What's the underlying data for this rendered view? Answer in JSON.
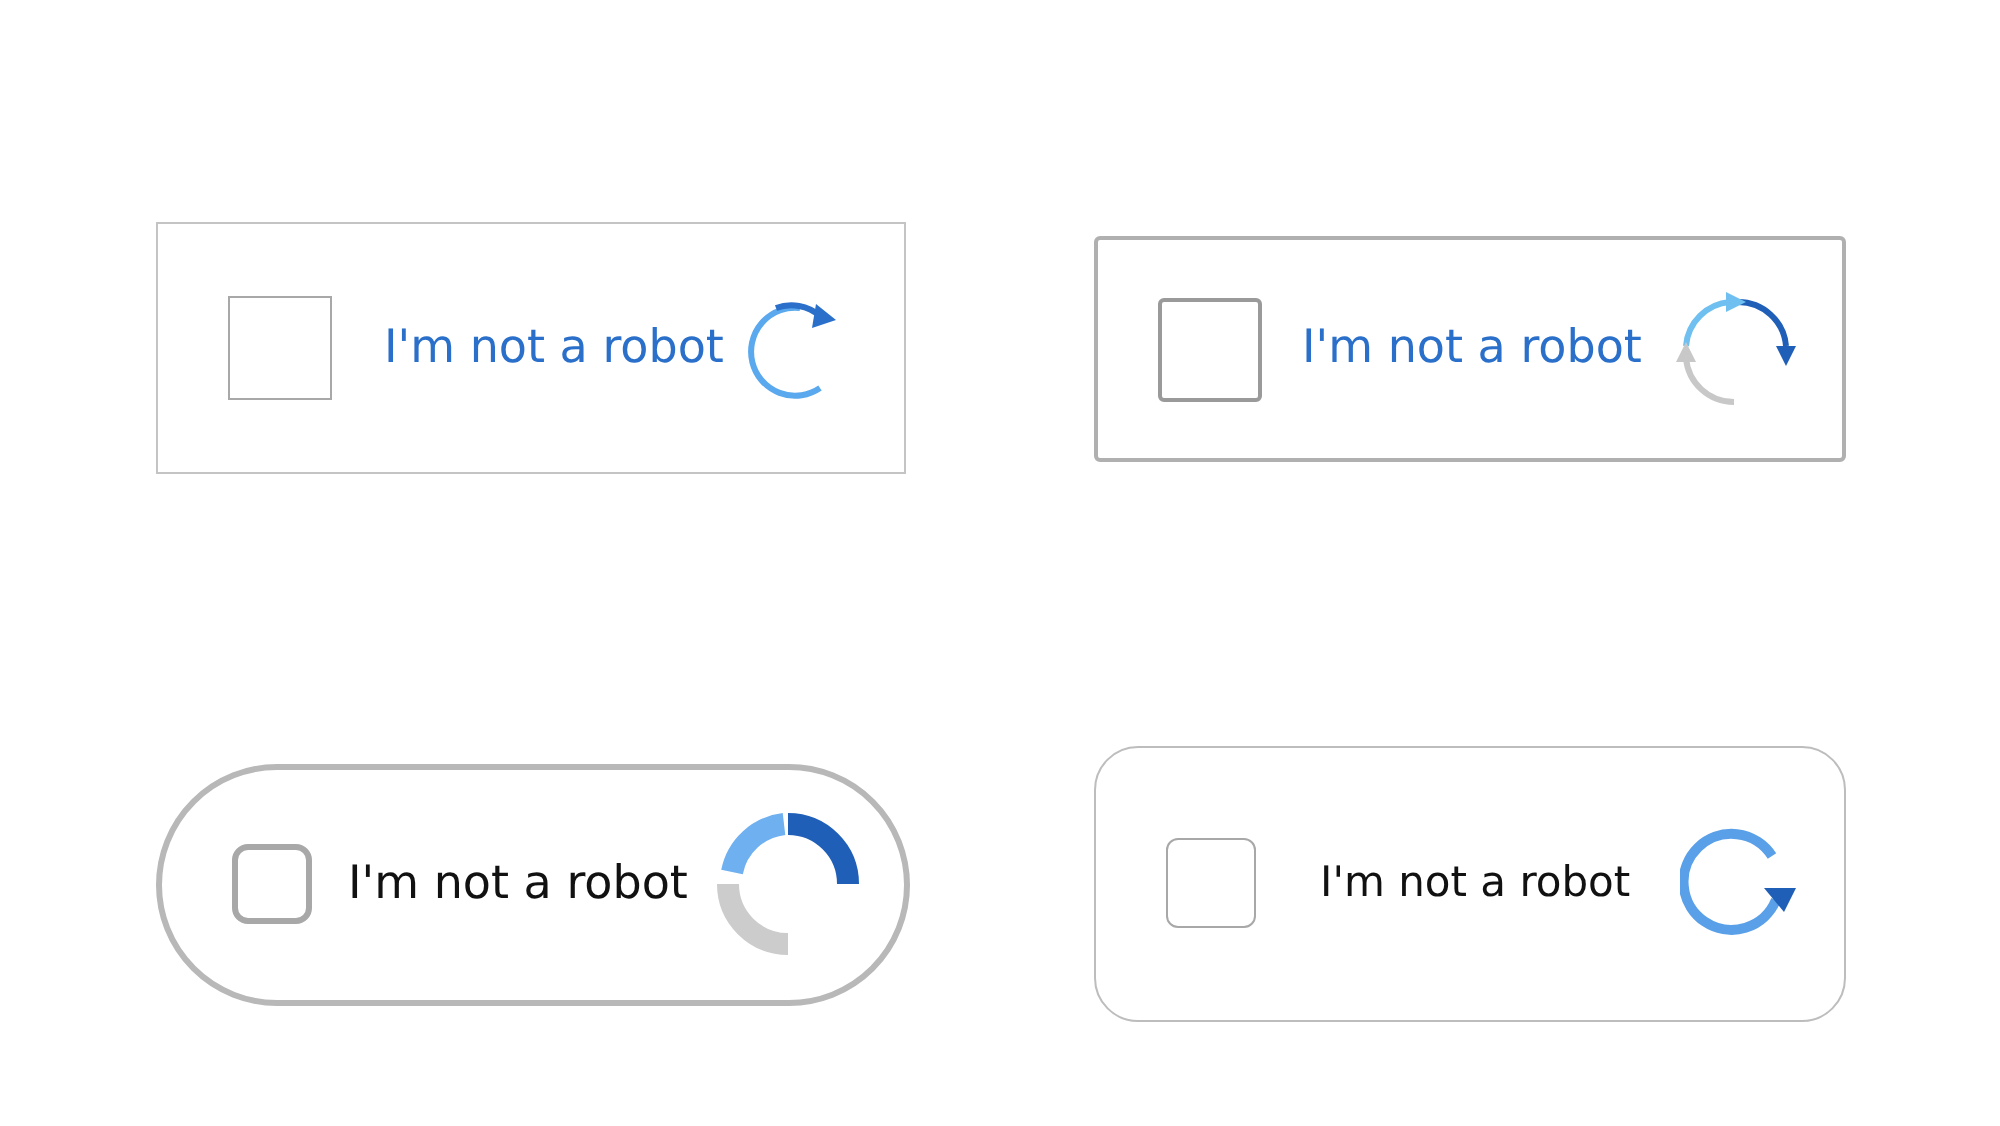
{
  "widgets": [
    {
      "kind": "square",
      "label": "I'm not a robot",
      "checked": false
    },
    {
      "kind": "framed",
      "label": "I'm not a robot",
      "checked": false
    },
    {
      "kind": "pill",
      "label": "I'm not a robot",
      "checked": false
    },
    {
      "kind": "soft",
      "label": "I'm not a robot",
      "checked": false
    }
  ]
}
